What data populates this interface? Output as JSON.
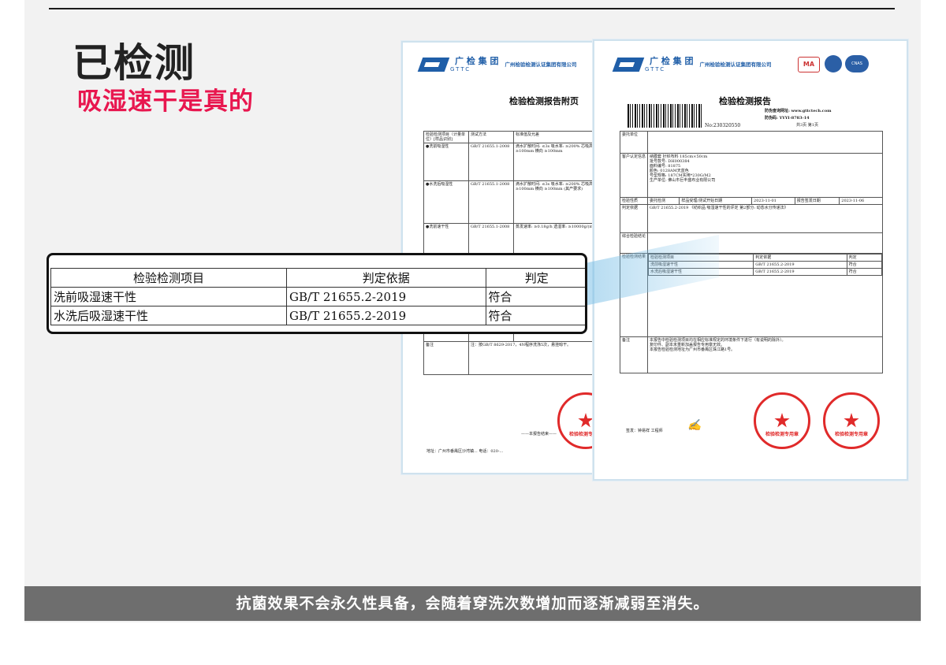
{
  "headline": "已检测",
  "subline": "吸湿速干是真的",
  "footer": "抗菌效果不会永久性具备，会随着穿洗次数增加而逐渐减弱至消失。",
  "colors": {
    "accent": "#e8174f",
    "footer_bg": "#6e6e6e",
    "panel_bg": "#f2f2f2",
    "seal": "#e02a2a",
    "brand_blue": "#1f5ea8"
  },
  "left_report": {
    "brand_cn": "广 检 集 团",
    "brand_en": "GTTC",
    "lab_name": "广州检验检测认证集团有限公司",
    "title": "检验检测报告附页",
    "table_head": [
      "检验检测项目（计量单位）[样品识别]",
      "测试方法",
      "标准值及允差"
    ],
    "rows": [
      {
        "item": "●洗前吸湿性",
        "method": "GB/T 21655.1-2008",
        "std": "滴水扩散时间: ≤3s 吸水率: ≥200% 芯吸高度: 直向 ≥100mm 横向 ≥100mm"
      },
      {
        "item": "●水洗后吸湿性",
        "method": "GB/T 21655.1-2008",
        "std": "滴水扩散时间: ≤3s 吸水率: ≥200% 芯吸高度: 直向 ≥100mm 横向 ≥100mm (其产要求)"
      },
      {
        "item": "●洗前速干性",
        "method": "GB/T 21655.1-2008",
        "std": "蒸发速率: ≥0.18g/h 透湿率: ≥10000g/(m²·24h)"
      }
    ],
    "remark_label": "备注",
    "remark_text": "注：按GB/T 8629-2017，4N程序洗涤5次，悬挂晾干。",
    "footer_note": "——本报告结束——",
    "address": "地址：广州市番禺区沙湾镇...  电话：020-..."
  },
  "right_report": {
    "brand_cn": "广 检 集 团",
    "brand_en": "GTTC",
    "lab_name": "广州检验检测认证集团有限公司",
    "cert_ma": "MA",
    "cert_cnas": "CNAS",
    "title": "检验检测报告",
    "verify_url": "防伪查询网址: www.gttctech.com",
    "verify_code": "防伪码: YYYI-8783-14",
    "report_no": "No:230320550",
    "page_info": "共3页 第1页",
    "client_label": "委托单位",
    "sample_label": "客户认定信息",
    "sample_info": [
      "纳膜套 针织布料 185cm×50cm",
      "批号款号: DH000384",
      "面料编号: 81875",
      "颜色: 0128AM天蓝色",
      "号型规格: 187CM实用*230G/M2",
      "生产单位: 佛山市巨丰盛布业有限公司"
    ],
    "inspect_type_label": "检验性质",
    "inspect_type": "委托检测",
    "received_label": "样品受理/测试开始日期",
    "received_date": "2023-11-01",
    "issued_label": "报告签发日期",
    "issued_date": "2023-11-06",
    "basis_label": "判定依据",
    "basis_text": "GB/T 21655.2-2019 《纺织品 吸湿速干性的评定 第2部分: 动态水分传递法》",
    "conclusion_label": "综合检验结论",
    "results_label": "检验检测结果",
    "result_head": [
      "检验检测项目",
      "判定依据",
      "判定"
    ],
    "results": [
      [
        "洗前吸湿速干性",
        "GB/T 21655.2-2019",
        "符合"
      ],
      [
        "水洗后吸湿速干性",
        "GB/T 21655.2-2019",
        "符合"
      ]
    ],
    "remark_label": "备注",
    "remark_lines": [
      "本报告中检验检测项目均在相应标准规定的环境条件下进行（有说明的除外）。",
      "复印件、副本未重新加盖报告专用章无效。",
      "本报告检验检测地址为广州市番禺区珠江路1号。"
    ],
    "sign_label": "签发：",
    "signer": "钟易祥 工程师",
    "seal_text": "检验检测专用章"
  },
  "callout": {
    "head": [
      "检验检测项目",
      "判定依据",
      "判定"
    ],
    "rows": [
      [
        "洗前吸湿速干性",
        "GB/T 21655.2-2019",
        "符合"
      ],
      [
        "水洗后吸湿速干性",
        "GB/T 21655.2-2019",
        "符合"
      ]
    ]
  }
}
